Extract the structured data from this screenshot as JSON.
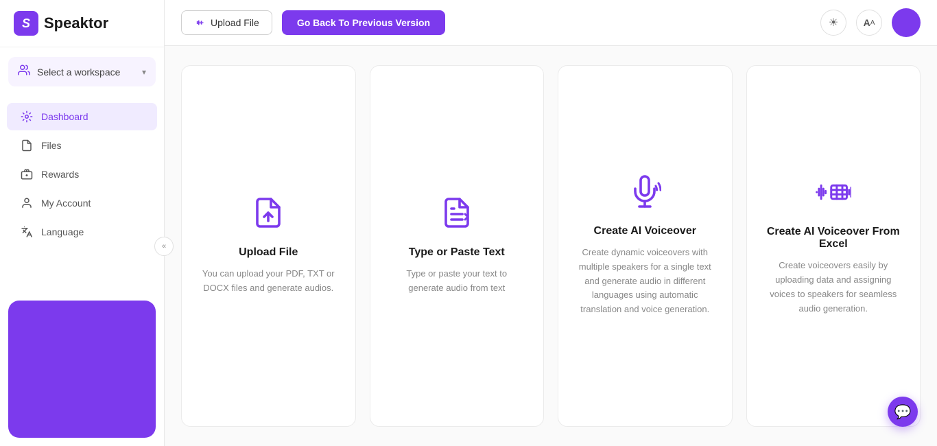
{
  "app": {
    "name": "Speaktor",
    "logo_letter": "S"
  },
  "sidebar": {
    "workspace": {
      "label": "Select a workspace",
      "chevron": "▾"
    },
    "nav_items": [
      {
        "id": "dashboard",
        "label": "Dashboard",
        "active": true
      },
      {
        "id": "files",
        "label": "Files",
        "active": false
      },
      {
        "id": "rewards",
        "label": "Rewards",
        "active": false
      },
      {
        "id": "my-account",
        "label": "My Account",
        "active": false
      },
      {
        "id": "language",
        "label": "Language",
        "active": false
      }
    ],
    "collapse_tooltip": "Collapse"
  },
  "topbar": {
    "upload_button": "Upload File",
    "go_back_button": "Go Back To Previous Version",
    "theme_icon": "☀",
    "translate_icon": "A"
  },
  "cards": [
    {
      "id": "upload-file",
      "title": "Upload File",
      "description": "You can upload your PDF, TXT or DOCX files and generate audios."
    },
    {
      "id": "type-paste",
      "title": "Type or Paste Text",
      "description": "Type or paste your text to generate audio from text"
    },
    {
      "id": "ai-voiceover",
      "title": "Create AI Voiceover",
      "description": "Create dynamic voiceovers with multiple speakers for a single text and generate audio in different languages using automatic translation and voice generation."
    },
    {
      "id": "ai-voiceover-excel",
      "title": "Create AI Voiceover From Excel",
      "description": "Create voiceovers easily by uploading data and assigning voices to speakers for seamless audio generation."
    }
  ],
  "colors": {
    "purple": "#7c3aed",
    "purple_light": "#f0ebff"
  }
}
